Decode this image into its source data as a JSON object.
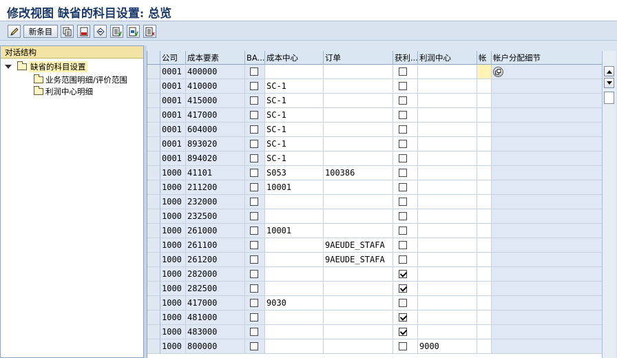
{
  "title": "修改视图 缺省的科目设置: 总览",
  "toolbar": {
    "new_entries_label": "新条目",
    "icons": [
      "edit-icon",
      "copy-icon",
      "delete-icon",
      "undo-icon",
      "select-all-icon",
      "select-block-icon",
      "deselect-all-icon"
    ]
  },
  "tree": {
    "header": "对话结构",
    "root": "缺省的科目设置",
    "children": [
      "业务范围明细/评价范围",
      "利润中心明细"
    ]
  },
  "table": {
    "columns": [
      "公司",
      "成本要素",
      "BA...",
      "成本中心",
      "订单",
      "获利...",
      "利润中心",
      "帐",
      "帐户分配细节"
    ],
    "rows": [
      {
        "company": "0001",
        "element": "400000",
        "cost_center": "",
        "order": "",
        "profit": false,
        "profit_center": ""
      },
      {
        "company": "0001",
        "element": "410000",
        "cost_center": "SC-1",
        "order": "",
        "profit": false,
        "profit_center": ""
      },
      {
        "company": "0001",
        "element": "415000",
        "cost_center": "SC-1",
        "order": "",
        "profit": false,
        "profit_center": ""
      },
      {
        "company": "0001",
        "element": "417000",
        "cost_center": "SC-1",
        "order": "",
        "profit": false,
        "profit_center": ""
      },
      {
        "company": "0001",
        "element": "604000",
        "cost_center": "SC-1",
        "order": "",
        "profit": false,
        "profit_center": ""
      },
      {
        "company": "0001",
        "element": "893020",
        "cost_center": "SC-1",
        "order": "",
        "profit": false,
        "profit_center": ""
      },
      {
        "company": "0001",
        "element": "894020",
        "cost_center": "SC-1",
        "order": "",
        "profit": false,
        "profit_center": ""
      },
      {
        "company": "1000",
        "element": "41101",
        "cost_center": "S053",
        "order": "100386",
        "profit": false,
        "profit_center": ""
      },
      {
        "company": "1000",
        "element": "211200",
        "cost_center": "10001",
        "order": "",
        "profit": false,
        "profit_center": ""
      },
      {
        "company": "1000",
        "element": "232000",
        "cost_center": "",
        "order": "",
        "profit": false,
        "profit_center": ""
      },
      {
        "company": "1000",
        "element": "232500",
        "cost_center": "",
        "order": "",
        "profit": false,
        "profit_center": ""
      },
      {
        "company": "1000",
        "element": "261000",
        "cost_center": "10001",
        "order": "",
        "profit": false,
        "profit_center": ""
      },
      {
        "company": "1000",
        "element": "261100",
        "cost_center": "",
        "order": "9AEUDE_STAFA",
        "profit": false,
        "profit_center": ""
      },
      {
        "company": "1000",
        "element": "261200",
        "cost_center": "",
        "order": "9AEUDE_STAFA",
        "profit": false,
        "profit_center": ""
      },
      {
        "company": "1000",
        "element": "282000",
        "cost_center": "",
        "order": "",
        "profit": true,
        "profit_center": ""
      },
      {
        "company": "1000",
        "element": "282500",
        "cost_center": "",
        "order": "",
        "profit": true,
        "profit_center": ""
      },
      {
        "company": "1000",
        "element": "417000",
        "cost_center": "9030",
        "order": "",
        "profit": false,
        "profit_center": ""
      },
      {
        "company": "1000",
        "element": "481000",
        "cost_center": "",
        "order": "",
        "profit": true,
        "profit_center": ""
      },
      {
        "company": "1000",
        "element": "483000",
        "cost_center": "",
        "order": "",
        "profit": true,
        "profit_center": ""
      },
      {
        "company": "1000",
        "element": "800000",
        "cost_center": "",
        "order": "",
        "profit": false,
        "profit_center": "9000"
      }
    ]
  }
}
